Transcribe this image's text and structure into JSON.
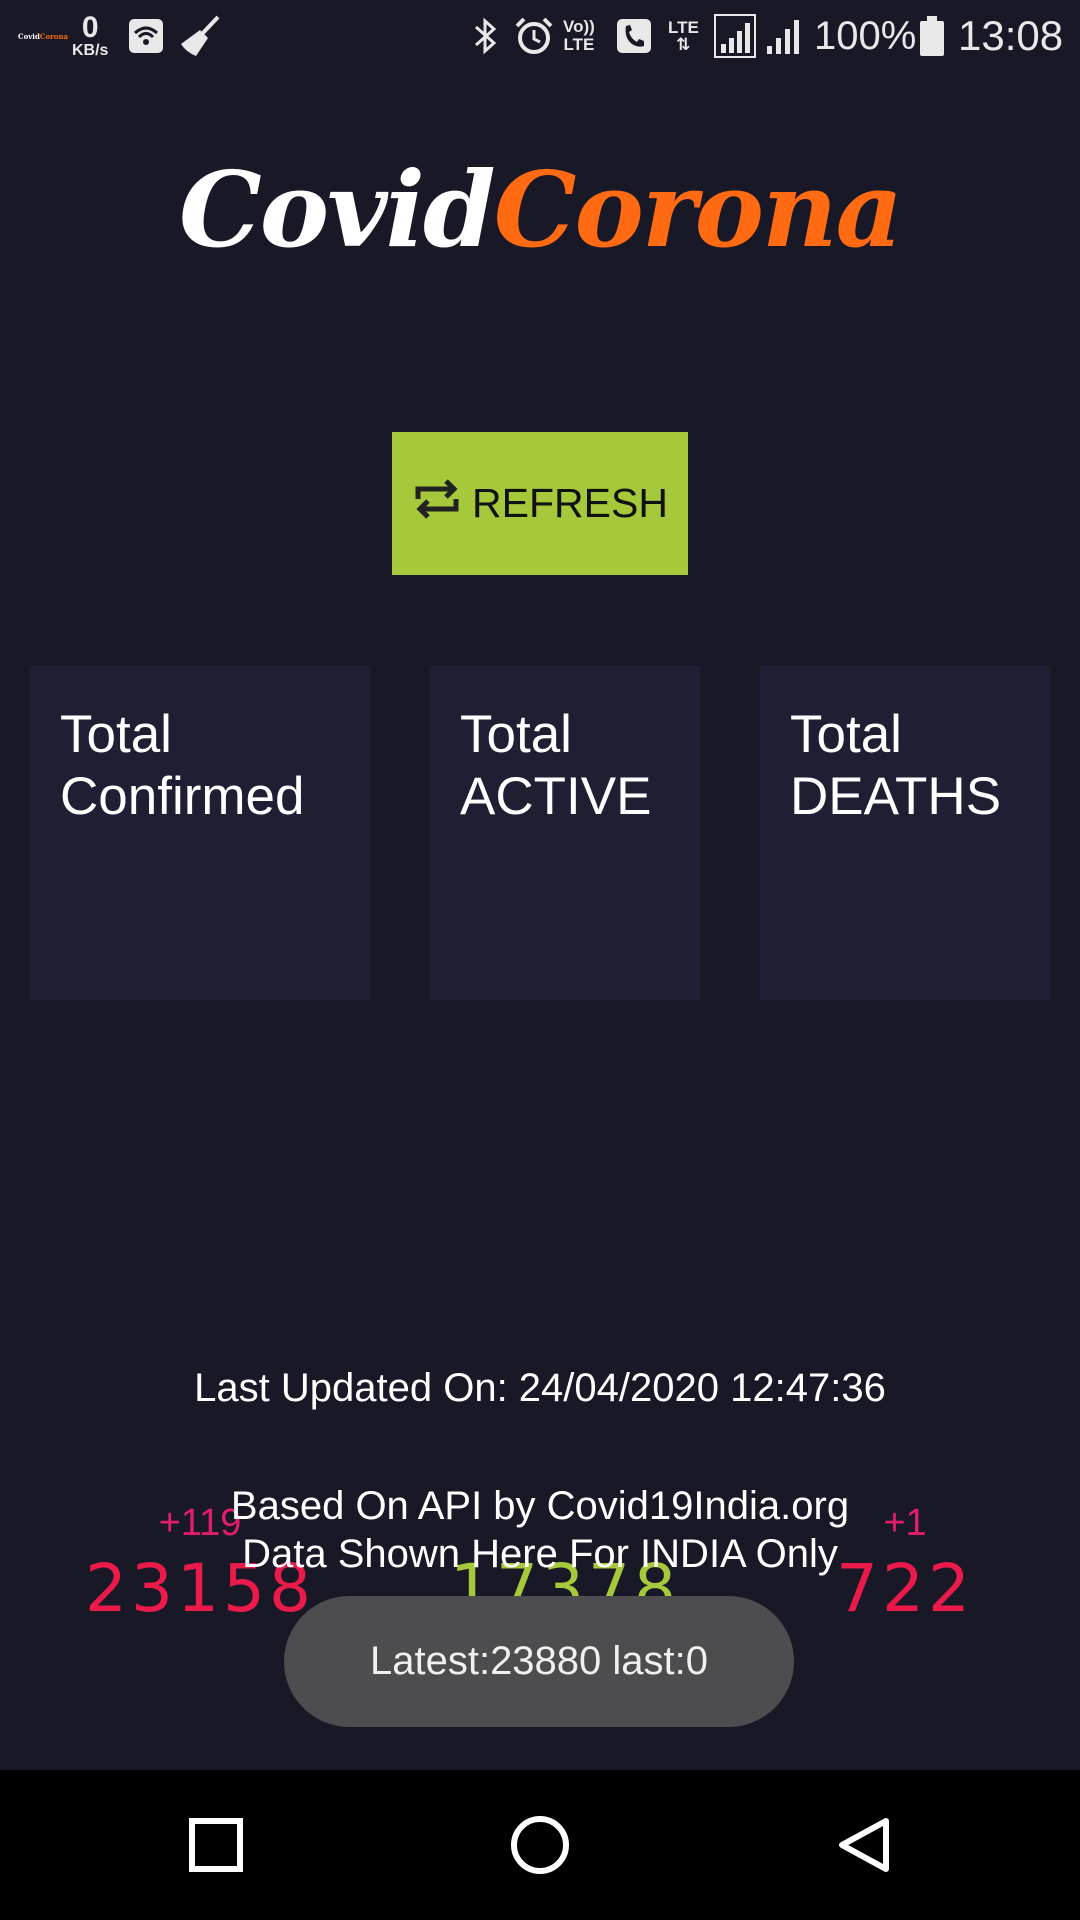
{
  "status_bar": {
    "app_logo_white": "Covid",
    "app_logo_orange": "Corona",
    "net_speed_value": "0",
    "net_speed_unit": "KB/s",
    "volte_line1": "Vo))",
    "volte_line2": "LTE",
    "lte_label": "LTE",
    "battery_percent": "100%",
    "time": "13:08"
  },
  "header": {
    "logo_white": "Covid",
    "logo_orange": "Corona",
    "logo_orange_color": "#ff6a12"
  },
  "refresh_button": {
    "label": "REFRESH",
    "icon": "refresh-arrows-icon",
    "background": "#a5c93a"
  },
  "stats": {
    "confirmed": {
      "label_line1": "Total",
      "label_line2": "Confirmed",
      "delta": "+119",
      "value": "23158",
      "color": "#e8174a"
    },
    "active": {
      "label_line1": "Total",
      "label_line2": "ACTIVE",
      "delta": "",
      "value": "17378",
      "color": "#a5c93a"
    },
    "deaths": {
      "label_line1": "Total",
      "label_line2": "DEATHS",
      "delta": "+1",
      "value": "722",
      "color": "#e8174a"
    }
  },
  "footer": {
    "last_updated": "Last Updated On: 24/04/2020 12:47:36",
    "api_line1": "Based On API by Covid19India.org",
    "api_line2": "Data Shown Here For INDIA Only"
  },
  "toast": {
    "text": "Latest:23880 last:0"
  },
  "nav": {
    "recent_icon": "square-recents-icon",
    "home_icon": "circle-home-icon",
    "back_icon": "triangle-back-icon"
  }
}
